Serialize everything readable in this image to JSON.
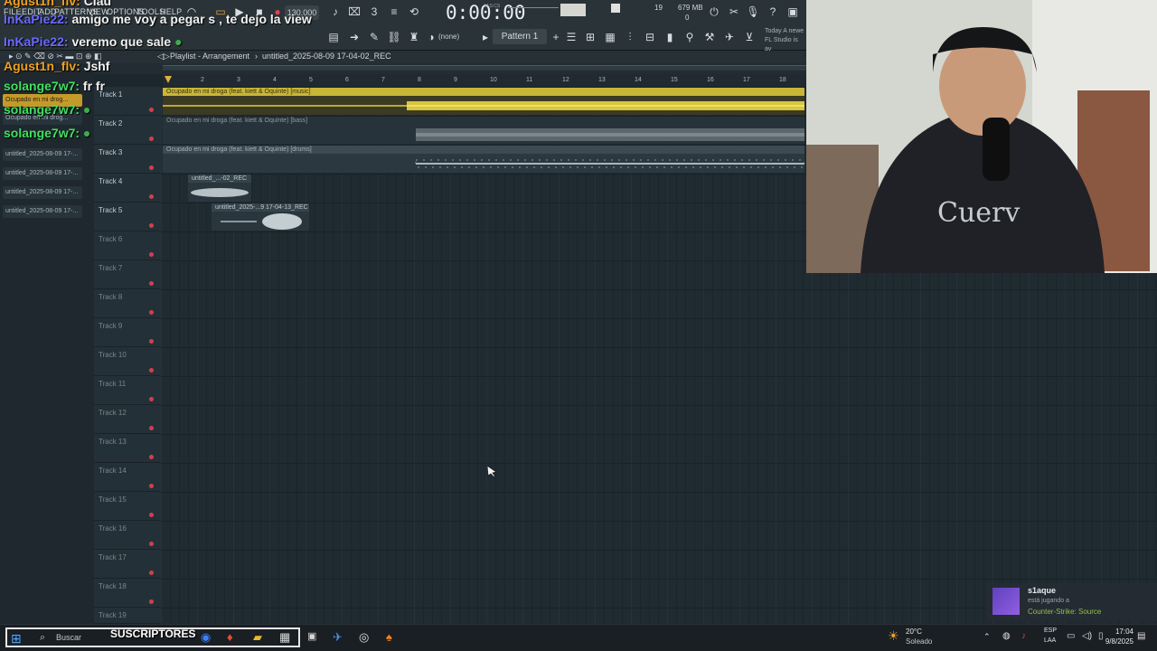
{
  "chat": [
    {
      "user": "Agust1n_flv:",
      "message": "Clau",
      "color": "#f0a020"
    },
    {
      "user": "InKaPie22:",
      "message": "amigo me voy a pegar s , te dejo la view",
      "color": "#6a6aff"
    },
    {
      "user": "InKaPie22:",
      "message": "veremo que sale",
      "color": "#6a6aff"
    },
    {
      "user": "Agust1n_flv:",
      "message": "Jshf",
      "color": "#f0a020"
    },
    {
      "user": "solange7w7:",
      "message": "fr fr",
      "color": "#40e060"
    },
    {
      "user": "solange7w7:",
      "message": "",
      "color": "#40e060"
    },
    {
      "user": "solange7w7:",
      "message": "",
      "color": "#40e060"
    }
  ],
  "toolbar": {
    "menu": [
      "FILE",
      "EDIT",
      "ADD",
      "PATTERNS",
      "VIEW",
      "OPTIONS",
      "TOOLS",
      "HELP"
    ],
    "tempo": "130.000",
    "time": "0:00:00",
    "time_unit": "M:S:CS",
    "memory_line1": "19",
    "memory_line2": "679 MB",
    "memory_line3": "0",
    "none_label": "(none)",
    "pattern": "Pattern 1",
    "hint_line1": "Today  A newe",
    "hint_line2": "FL Studio is av"
  },
  "playlist": {
    "title": "Playlist - Arrangement",
    "project": "untitled_2025-08-09 17-04-02_REC",
    "ruler": [
      "2",
      "3",
      "4",
      "5",
      "6",
      "7",
      "8",
      "9",
      "10",
      "11",
      "12",
      "13",
      "14",
      "15",
      "16",
      "17",
      "18"
    ]
  },
  "browser": {
    "items": [
      "Ocupado en mi drog...",
      "Ocupado en mi drog...",
      "untitled_2025-08-09 17-...",
      "untitled_2025-08-09 17-...",
      "untitled_2025-08-09 17-...",
      "untitled_2025-08-09 17-..."
    ]
  },
  "tracks": [
    "Track 1",
    "Track 2",
    "Track 3",
    "Track 4",
    "Track 5",
    "Track 6",
    "Track 7",
    "Track 8",
    "Track 9",
    "Track 10",
    "Track 11",
    "Track 12",
    "Track 13",
    "Track 14",
    "Track 15",
    "Track 16",
    "Track 17",
    "Track 18",
    "Track 19"
  ],
  "clips": {
    "music": "Ocupado en mi droga (feat. kiett & Oquinte) [music]",
    "bass": "Ocupado en mi droga (feat. kiett & Oquinte) [bass]",
    "drums": "Ocupado en mi droga (feat. kiett & Oquinte) [drums]",
    "rec1": "untitled_...-02_REC",
    "rec2": "untitled_2025-...9 17-04-13_REC"
  },
  "taskbar": {
    "search": "Buscar",
    "subscribers": "SUSCRIPTORES",
    "weather_temp": "20°C",
    "weather_desc": "Soleado",
    "lang1": "ESP",
    "lang2": "LAA",
    "time": "17:04",
    "date": "9/8/2025"
  },
  "notification": {
    "user": "s1aque",
    "line1": "está jugando a",
    "line2": "Counter-Strike: Source"
  },
  "webcam": {
    "shirt_text": "Cuerv"
  },
  "colors": {
    "accent": "#d7c34a",
    "track_dot": "#d04050",
    "grid_bg": "#1f2a31"
  }
}
